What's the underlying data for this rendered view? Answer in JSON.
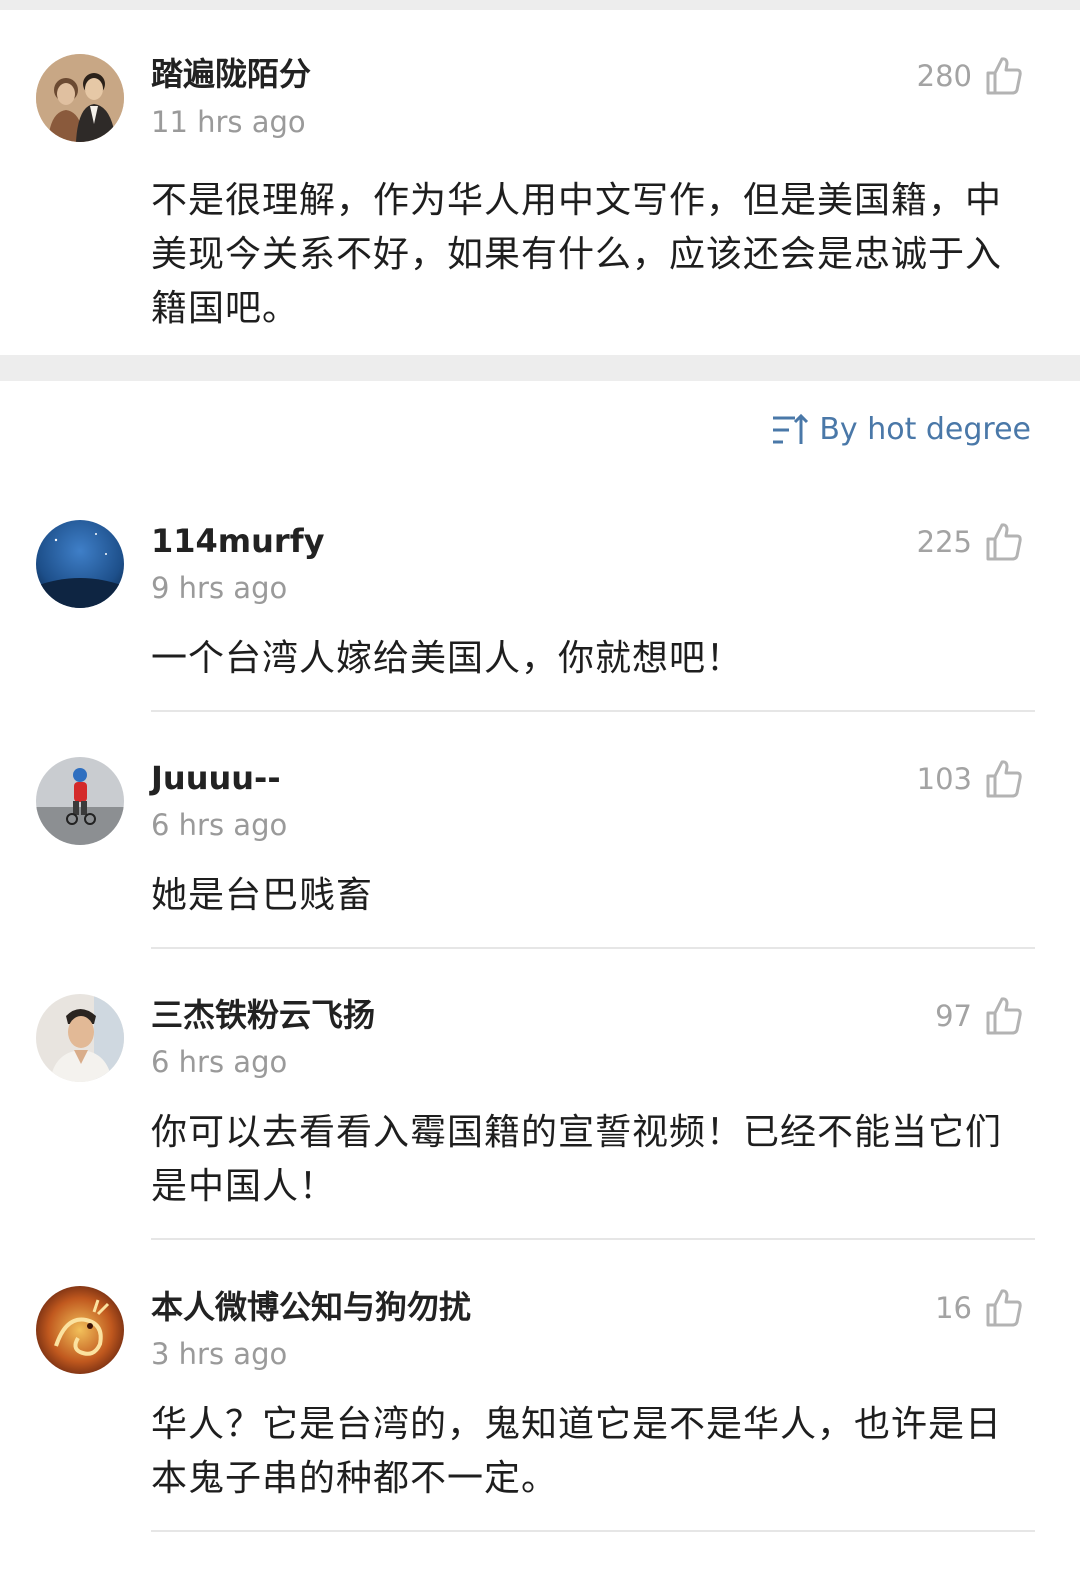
{
  "pinned_comment": {
    "username": "踏遍陇陌分",
    "time": "11 hrs ago",
    "likes": "280",
    "text": "不是很理解，作为华人用中文写作，但是美国籍，中美现今关系不好，如果有什么，应该还会是忠诚于入籍国吧。"
  },
  "sort": {
    "label": "By hot degree",
    "icon": "sort-icon"
  },
  "comments": [
    {
      "username": "114murfy",
      "time": "9 hrs ago",
      "likes": "225",
      "text": "一个台湾人嫁给美国人，你就想吧！"
    },
    {
      "username": "Juuuu--",
      "time": "6 hrs ago",
      "likes": "103",
      "text": "她是台巴贱畜"
    },
    {
      "username": "三杰铁粉云飞扬",
      "time": "6 hrs ago",
      "likes": "97",
      "text": "你可以去看看入霉国籍的宣誓视频！已经不能当它们是中国人！"
    },
    {
      "username": "本人微博公知与狗勿扰",
      "time": "3 hrs ago",
      "likes": "16",
      "text": "华人？它是台湾的，鬼知道它是不是华人，也许是日本鬼子串的种都不一定。"
    }
  ],
  "colors": {
    "accent": "#4a78a8",
    "muted": "#9a9a9a",
    "separator": "#ededed"
  }
}
